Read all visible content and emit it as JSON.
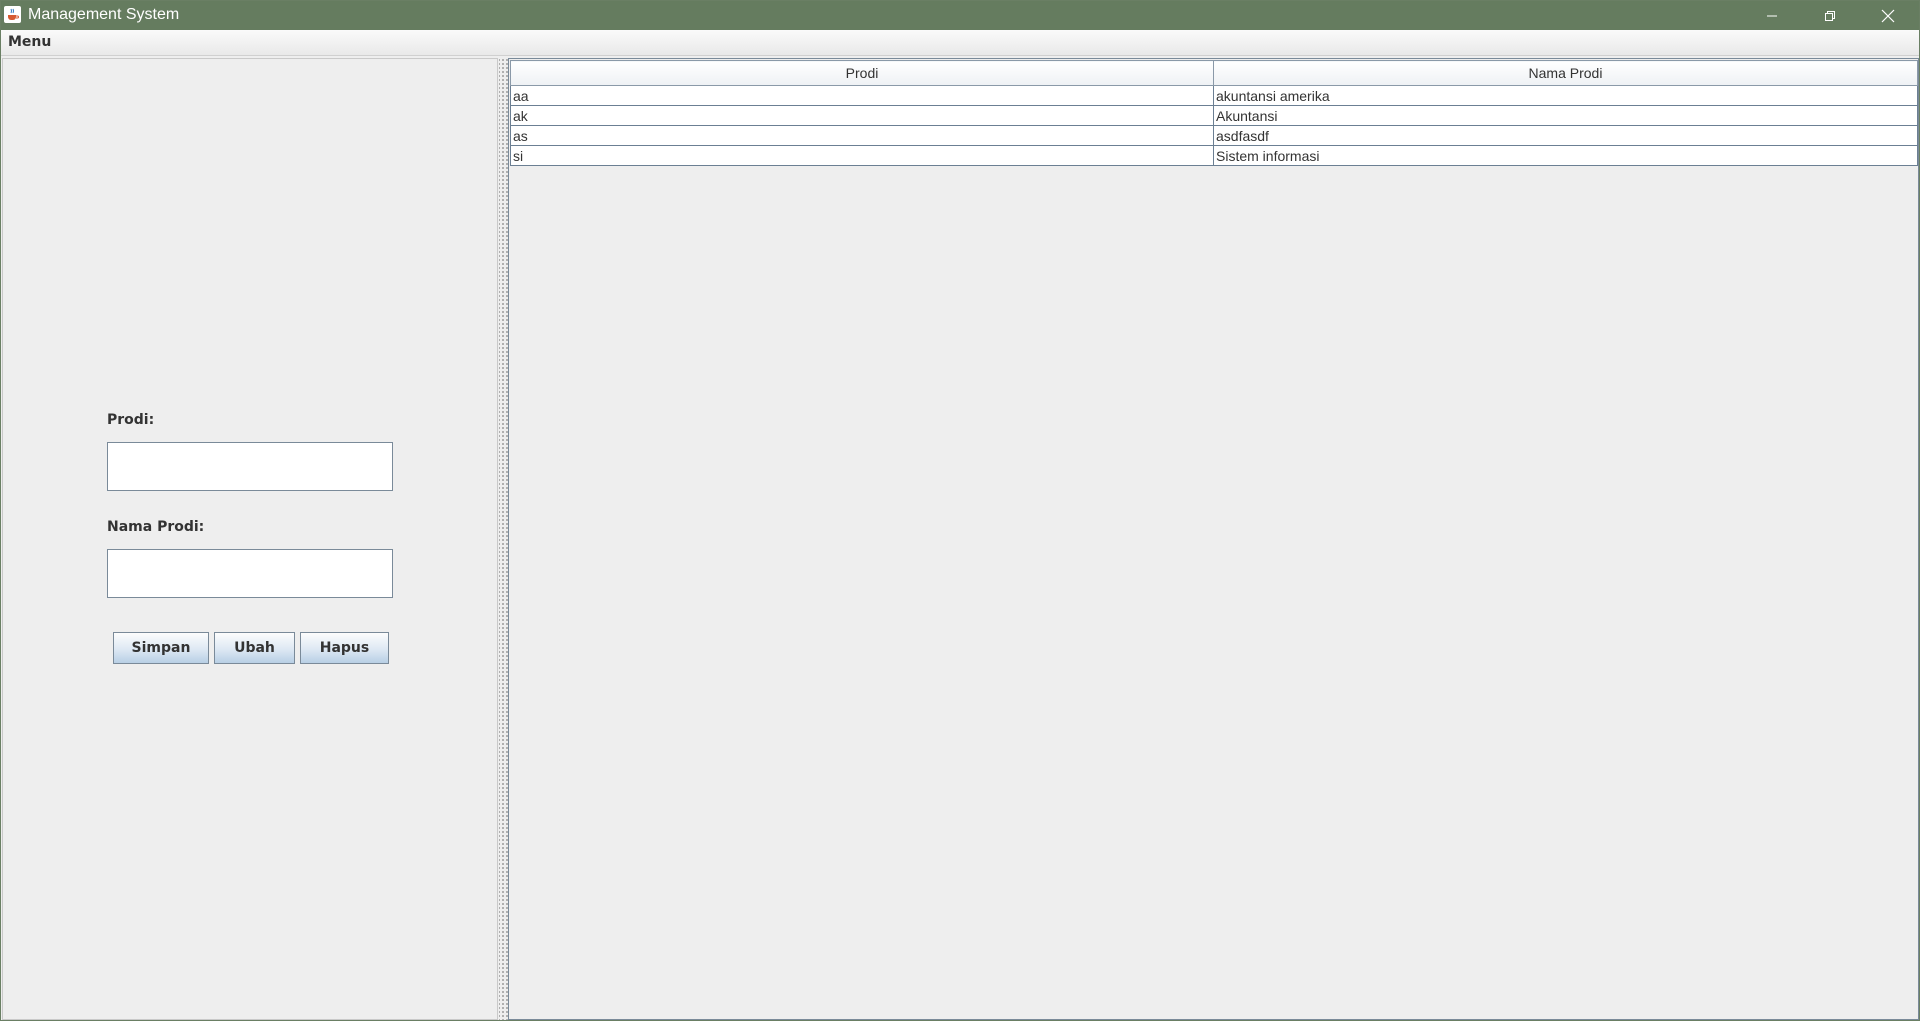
{
  "window": {
    "title": "Management System",
    "icon": "java-cup-icon"
  },
  "menubar": {
    "menu_label": "Menu"
  },
  "form": {
    "prodi_label": "Prodi:",
    "prodi_value": "",
    "nama_label": "Nama Prodi:",
    "nama_value": "",
    "buttons": {
      "simpan": "Simpan",
      "ubah": "Ubah",
      "hapus": "Hapus"
    }
  },
  "table": {
    "columns": [
      "Prodi",
      "Nama Prodi"
    ],
    "rows": [
      [
        "aa",
        "akuntansi amerika"
      ],
      [
        "ak",
        "Akuntansi"
      ],
      [
        "as",
        "asdfasdf"
      ],
      [
        "si",
        "Sistem informasi"
      ]
    ]
  },
  "colors": {
    "titlebar": "#657c5f",
    "button_gradient_bottom": "#b8cfe5",
    "panel_bg": "#eeeeee"
  }
}
